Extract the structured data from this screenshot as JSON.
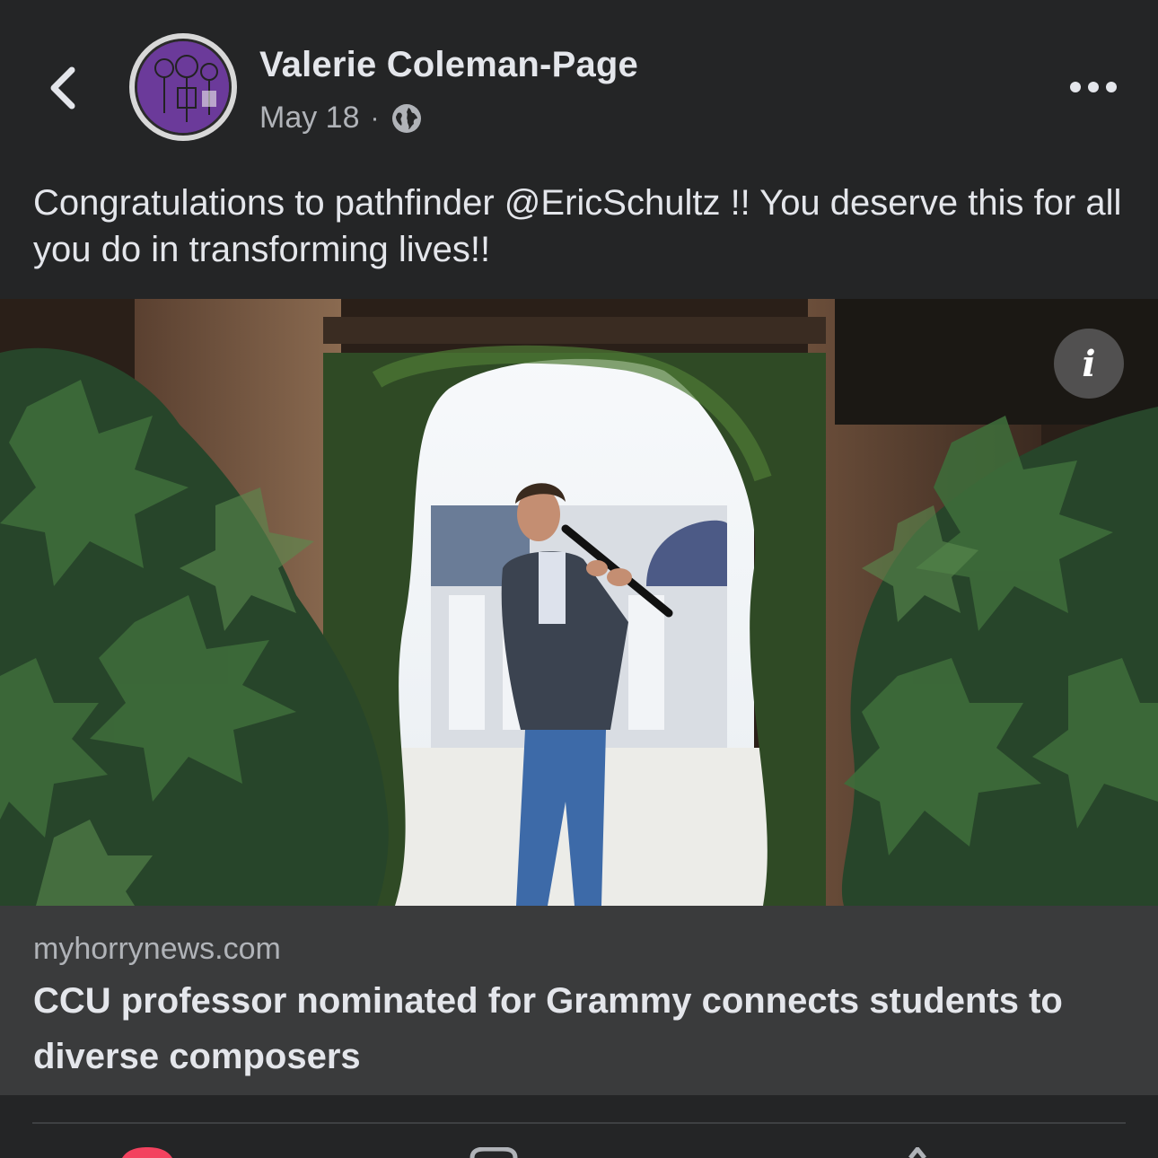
{
  "header": {
    "author_name": "Valerie Coleman-Page",
    "date": "May 18",
    "separator": "·",
    "privacy_icon": "globe-icon",
    "back_icon": "chevron-left-icon",
    "more_icon": "more-horizontal-icon"
  },
  "post": {
    "text": "Congratulations to pathfinder @EricSchultz !! You deserve this for all you do in transforming lives!!"
  },
  "photo": {
    "info_label": "i"
  },
  "link_preview": {
    "domain": "myhorrynews.com",
    "title": "CCU professor nominated for Grammy connects students to diverse composers"
  },
  "actions": {
    "icons": [
      "like-reaction-icon",
      "comment-icon",
      "share-icon"
    ]
  },
  "colors": {
    "background": "#242526",
    "link_card": "#3a3b3c",
    "text_primary": "#e4e6eb",
    "text_secondary": "#b0b3b8",
    "avatar_purple": "#6b3a9a",
    "like_red": "#f3425f"
  }
}
